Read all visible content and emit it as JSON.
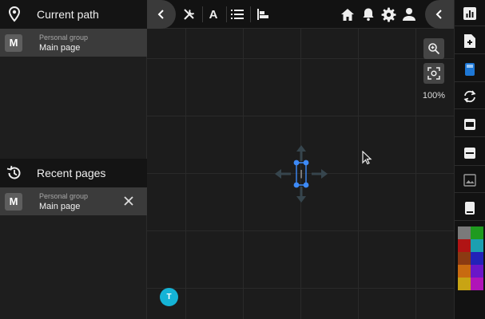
{
  "current_path": {
    "title": "Current path",
    "item": {
      "badge": "M",
      "group": "Personal group",
      "page": "Main page"
    }
  },
  "recent_pages": {
    "title": "Recent pages",
    "items": [
      {
        "badge": "M",
        "group": "Personal group",
        "page": "Main page"
      }
    ]
  },
  "toolbar": {
    "text_tool_label": "A",
    "left_icons": [
      "tools-icon",
      "text-icon",
      "list-icon",
      "align-icon"
    ],
    "right_icons": [
      "home-icon",
      "bell-icon",
      "gear-icon",
      "user-icon"
    ]
  },
  "canvas": {
    "zoom_level": "100%",
    "user_avatar": "T",
    "selected_element_text": "|"
  },
  "right_bar": {
    "icons": [
      "chart-icon",
      "add-page-icon",
      "calculator-icon",
      "refresh-icon",
      "card-icon",
      "minus-icon",
      "image-icon",
      "tablet-icon"
    ]
  },
  "palette": {
    "colors": [
      "#7a7a7a",
      "#1f9a1f",
      "#b01414",
      "#1c9fb0",
      "#8b3a12",
      "#2222b8",
      "#c86a10",
      "#6a16c8",
      "#c8a414",
      "#b014b8"
    ]
  },
  "colors": {
    "accent": "#3d8af7",
    "avatar": "#15b3d6",
    "active_item": "#3b3b3b"
  }
}
